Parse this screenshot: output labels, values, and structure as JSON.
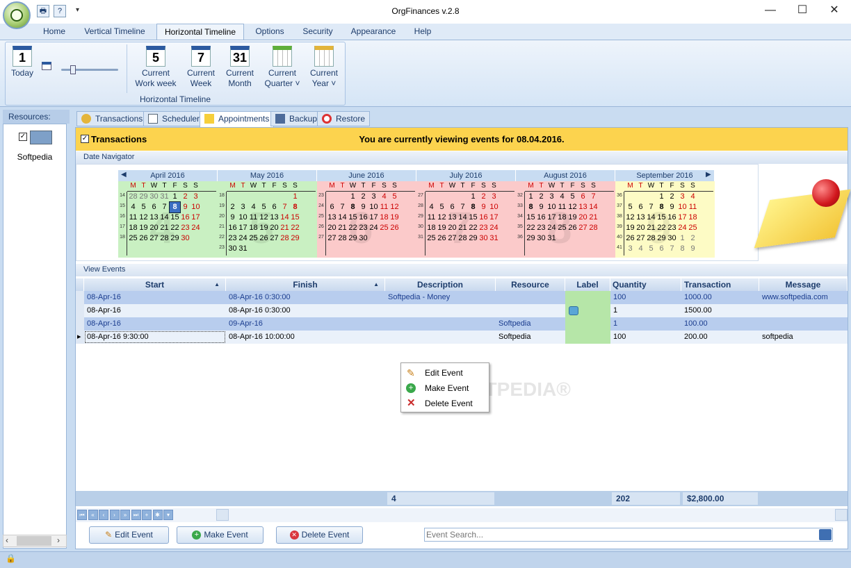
{
  "window": {
    "title": "OrgFinances v.2.8",
    "minimize": "—",
    "maximize": "☐",
    "close": "✕"
  },
  "quick_access": {
    "print": "🖶",
    "help": "?",
    "dropdown": "▾"
  },
  "ribbon_tabs": [
    "Home",
    "Vertical Timeline",
    "Horizontal Timeline",
    "Options",
    "Security",
    "Appearance",
    "Help"
  ],
  "ribbon": {
    "today": {
      "num": "1",
      "label": "Today"
    },
    "work_week": {
      "num": "5",
      "label1": "Current",
      "label2": "Work week"
    },
    "week": {
      "num": "7",
      "label1": "Current",
      "label2": "Week"
    },
    "month": {
      "num": "31",
      "label1": "Current",
      "label2": "Month"
    },
    "quarter": {
      "label1": "Current",
      "label2": "Quarter ˅"
    },
    "year": {
      "label1": "Current",
      "label2": "Year ˅"
    },
    "group_label": "Horizontal Timeline"
  },
  "resources": {
    "header": "Resources:",
    "item": "Softpedia",
    "scroll_left": "‹",
    "scroll_right": "›"
  },
  "content_tabs": [
    "Transactions",
    "Scheduler",
    "Appointments",
    "Backup",
    "Restore"
  ],
  "banner": {
    "title": "Transactions",
    "message": "You are currently viewing events for 08.04.2016."
  },
  "sections": {
    "date_navigator": "Date Navigator",
    "view_events": "View Events"
  },
  "calendar": {
    "weekday_headers": [
      "M",
      "T",
      "W",
      "T",
      "F",
      "S",
      "S"
    ],
    "prev": "◀",
    "next": "▶",
    "months": [
      {
        "name": "April 2016",
        "bg": "#c9f0c2",
        "weeks": [
          "14",
          "15",
          "16",
          "17",
          "18"
        ],
        "rows": [
          [
            "28",
            "29",
            "30",
            "31",
            "1",
            "2",
            "3"
          ],
          [
            "4",
            "5",
            "6",
            "7",
            "8",
            "9",
            "10"
          ],
          [
            "11",
            "12",
            "13",
            "14",
            "15",
            "16",
            "17"
          ],
          [
            "18",
            "19",
            "20",
            "21",
            "22",
            "23",
            "24"
          ],
          [
            "25",
            "26",
            "27",
            "28",
            "29",
            "30",
            ""
          ]
        ],
        "watermark": "4"
      },
      {
        "name": "May 2016",
        "bg": "#c9f0c2",
        "weeks": [
          "18",
          "19",
          "20",
          "21",
          "22",
          "23"
        ],
        "rows": [
          [
            "",
            "",
            "",
            "",
            "",
            "",
            "1"
          ],
          [
            "2",
            "3",
            "4",
            "5",
            "6",
            "7",
            "8"
          ],
          [
            "9",
            "10",
            "11",
            "12",
            "13",
            "14",
            "15"
          ],
          [
            "16",
            "17",
            "18",
            "19",
            "20",
            "21",
            "22"
          ],
          [
            "23",
            "24",
            "25",
            "26",
            "27",
            "28",
            "29"
          ],
          [
            "30",
            "31",
            "",
            "",
            "",
            "",
            ""
          ]
        ],
        "watermark": "5"
      },
      {
        "name": "June 2016",
        "bg": "#fbcaca",
        "weeks": [
          "23",
          "24",
          "25",
          "26",
          "27"
        ],
        "rows": [
          [
            "",
            "",
            "1",
            "2",
            "3",
            "4",
            "5"
          ],
          [
            "6",
            "7",
            "8",
            "9",
            "10",
            "11",
            "12"
          ],
          [
            "13",
            "14",
            "15",
            "16",
            "17",
            "18",
            "19"
          ],
          [
            "20",
            "21",
            "22",
            "23",
            "24",
            "25",
            "26"
          ],
          [
            "27",
            "28",
            "29",
            "30",
            "",
            "",
            ""
          ]
        ],
        "watermark": "6"
      },
      {
        "name": "July 2016",
        "bg": "#fbcaca",
        "weeks": [
          "27",
          "28",
          "29",
          "30",
          "31"
        ],
        "rows": [
          [
            "",
            "",
            "",
            "",
            "1",
            "2",
            "3"
          ],
          [
            "4",
            "5",
            "6",
            "7",
            "8",
            "9",
            "10"
          ],
          [
            "11",
            "12",
            "13",
            "14",
            "15",
            "16",
            "17"
          ],
          [
            "18",
            "19",
            "20",
            "21",
            "22",
            "23",
            "24"
          ],
          [
            "25",
            "26",
            "27",
            "28",
            "29",
            "30",
            "31"
          ]
        ],
        "watermark": "7"
      },
      {
        "name": "August 2016",
        "bg": "#fbcaca",
        "weeks": [
          "32",
          "33",
          "34",
          "35",
          "36"
        ],
        "rows": [
          [
            "1",
            "2",
            "3",
            "4",
            "5",
            "6",
            "7"
          ],
          [
            "8",
            "9",
            "10",
            "11",
            "12",
            "13",
            "14"
          ],
          [
            "15",
            "16",
            "17",
            "18",
            "19",
            "20",
            "21"
          ],
          [
            "22",
            "23",
            "24",
            "25",
            "26",
            "27",
            "28"
          ],
          [
            "29",
            "30",
            "31",
            "",
            "",
            "",
            ""
          ]
        ],
        "watermark": "8"
      },
      {
        "name": "September 2016",
        "bg": "#fdfbc5",
        "weeks": [
          "36",
          "37",
          "38",
          "39",
          "40",
          "41"
        ],
        "rows": [
          [
            "",
            "",
            "",
            "1",
            "2",
            "3",
            "4"
          ],
          [
            "5",
            "6",
            "7",
            "8",
            "9",
            "10",
            "11"
          ],
          [
            "12",
            "13",
            "14",
            "15",
            "16",
            "17",
            "18"
          ],
          [
            "19",
            "20",
            "21",
            "22",
            "23",
            "24",
            "25"
          ],
          [
            "26",
            "27",
            "28",
            "29",
            "30",
            "1",
            "2"
          ],
          [
            "3",
            "4",
            "5",
            "6",
            "7",
            "8",
            "9"
          ]
        ],
        "watermark": "9"
      }
    ]
  },
  "table": {
    "columns": [
      "Start",
      "Finish",
      "Description",
      "Resource",
      "Label",
      "Quantity",
      "Transaction",
      "Message"
    ],
    "sort_arrow": "▲",
    "rows": [
      [
        "08-Apr-16",
        "08-Apr-16 0:30:00",
        "Softpedia - Money",
        "",
        "",
        "100",
        "1000.00",
        "www.softpedia.com"
      ],
      [
        "08-Apr-16",
        "08-Apr-16 0:30:00",
        "",
        "",
        "",
        "1",
        "1500.00",
        ""
      ],
      [
        "08-Apr-16",
        "09-Apr-16",
        "",
        "Softpedia",
        "",
        "1",
        "100.00",
        ""
      ],
      [
        "08-Apr-16 9:30:00",
        "08-Apr-16 10:00:00",
        "",
        "Softpedia",
        "",
        "100",
        "200.00",
        "softpedia"
      ]
    ],
    "footer": {
      "count": "4",
      "quantity_total": "202",
      "transaction_total": "$2,800.00"
    },
    "row_indicator": "▸"
  },
  "nav_buttons": [
    "⏮",
    "«",
    "‹",
    "›",
    "»",
    "⏭",
    "+",
    "✱",
    "▾"
  ],
  "buttons": {
    "edit": "Edit Event",
    "make": "Make Event",
    "delete": "Delete Event"
  },
  "search": {
    "placeholder": "Event Search..."
  },
  "context_menu": [
    "Edit Event",
    "Make Event",
    "Delete Event"
  ],
  "watermark": "SOFTPEDIA®",
  "status": {
    "lock": "🔒"
  }
}
